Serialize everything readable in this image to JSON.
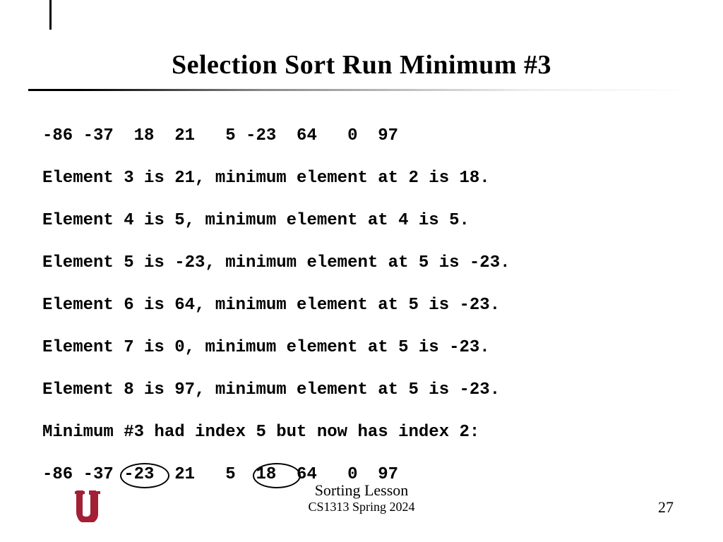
{
  "title": "Selection Sort Run Minimum #3",
  "array_before": "-86 -37  18  21   5 -23  64   0  97",
  "steps": [
    "Element 3 is 21, minimum element at 2 is 18.",
    "Element 4 is 5, minimum element at 4 is 5.",
    "Element 5 is -23, minimum element at 5 is -23.",
    "Element 6 is 64, minimum element at 5 is -23.",
    "Element 7 is 0, minimum element at 5 is -23.",
    "Element 8 is 97, minimum element at 5 is -23."
  ],
  "swap_line": "Minimum #3 had index 5 but now has index 2:",
  "array_after": "-86 -37 -23  21   5  18  64   0  97",
  "footer": {
    "lesson": "Sorting Lesson",
    "course": "CS1313 Spring 2024",
    "page": "27"
  },
  "logo": {
    "name": "OU",
    "color": "#a31f34"
  }
}
